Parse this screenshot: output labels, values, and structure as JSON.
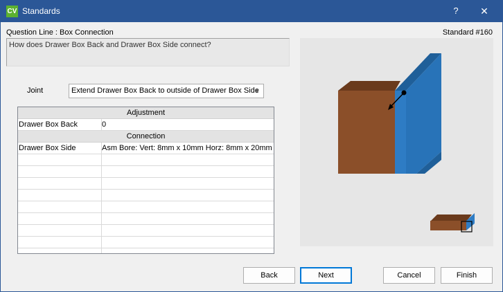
{
  "window": {
    "app_icon_text": "CV",
    "title": "Standards",
    "help_glyph": "?",
    "close_glyph": "✕"
  },
  "header": {
    "question_line": "Question Line : Box Connection",
    "standard_number": "Standard #160"
  },
  "question": {
    "text": "How does Drawer Box Back and Drawer Box Side connect?"
  },
  "joint": {
    "label": "Joint",
    "selected": "Extend Drawer Box Back to outside of Drawer Box Side"
  },
  "grid": {
    "adjustment_header": "Adjustment",
    "adjustment_rows": [
      {
        "name": "Drawer Box Back",
        "value": "0"
      }
    ],
    "connection_header": "Connection",
    "connection_rows": [
      {
        "name": "Drawer Box Side",
        "value": "Asm Bore: Vert: 8mm x 10mm Horz: 8mm x 20mm"
      }
    ]
  },
  "preview": {
    "back_color": "#8b4f29",
    "back_top_color": "#6a3a1c",
    "side_color": "#2e7cc4",
    "side_dark_color": "#1f5f99",
    "arrow_color": "#000000"
  },
  "buttons": {
    "back": "Back",
    "next": "Next",
    "cancel": "Cancel",
    "finish": "Finish"
  }
}
